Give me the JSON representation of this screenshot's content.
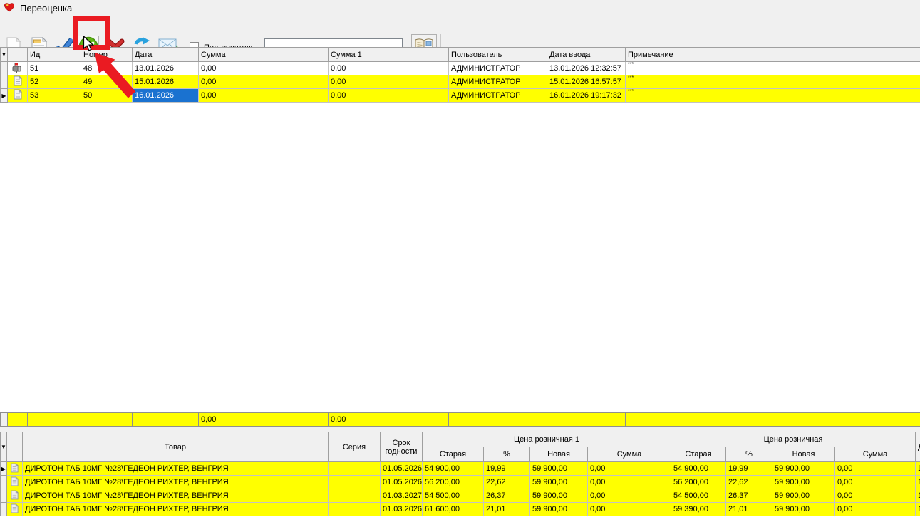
{
  "window": {
    "title": "Переоценка",
    "app_icon": "heart-icon"
  },
  "toolbar": {
    "buttons": [
      {
        "icon": "new-document-icon"
      },
      {
        "icon": "edit-document-icon"
      },
      {
        "icon": "blue-checkmark-icon"
      },
      {
        "icon": "green-approve-icon"
      },
      {
        "icon": "red-cross-icon"
      },
      {
        "icon": "refresh-icon"
      },
      {
        "icon": "send-mail-icon"
      },
      {
        "icon": "book-icon"
      }
    ],
    "user_checkbox_label": "Пользователь",
    "user_checkbox_checked": false,
    "user_input_value": ""
  },
  "icons": {
    "filter_arrow": "▼",
    "row_pointer": "▶"
  },
  "colors": {
    "row_highlight": "#ffff00",
    "cell_selection": "#1a72d0",
    "annotation_red": "#ea1b22"
  },
  "doc_table": {
    "columns": [
      "Ид",
      "Номер",
      "Дата",
      "Сумма",
      "Сумма 1",
      "Пользователь",
      "Дата ввода",
      "Примечание"
    ],
    "rows": [
      {
        "id": "51",
        "num": "48",
        "date": "13.01.2026",
        "sum": "0,00",
        "sum1": "0,00",
        "user": "АДМИНИСТРАТОР",
        "entered": "13.01.2026 12:32:57",
        "note": "***"
      },
      {
        "id": "52",
        "num": "49",
        "date": "15.01.2026",
        "sum": "0,00",
        "sum1": "0,00",
        "user": "АДМИНИСТРАТОР",
        "entered": "15.01.2026 16:57:57",
        "note": "***"
      },
      {
        "id": "53",
        "num": "50",
        "date": "16.01.2026",
        "sum": "0,00",
        "sum1": "0,00",
        "user": "АДМИНИСТРАТОР",
        "entered": "16.01.2026 19:17:32",
        "note": "***"
      }
    ],
    "summary": {
      "sum": "0,00",
      "sum1": "0,00"
    }
  },
  "items_table": {
    "col_product": "Товар",
    "col_series": "Серия",
    "col_expiry": "Срок годности",
    "group1": "Цена розничная 1",
    "group2": "Цена розничная",
    "sub": [
      "Старая",
      "%",
      "Новая",
      "Сумма"
    ],
    "last_col_header": "Д",
    "rows": [
      {
        "product": "ДИРОТОН ТАБ 10МГ №28\\ГЕДЕОН РИХТЕР, ВЕНГРИЯ",
        "series": "",
        "expiry": "01.05.2026",
        "p1": [
          "54 900,00",
          "19,99",
          "59 900,00",
          "0,00"
        ],
        "p2": [
          "54 900,00",
          "19,99",
          "59 900,00",
          "0,00"
        ],
        "extra": "1"
      },
      {
        "product": "ДИРОТОН ТАБ 10МГ №28\\ГЕДЕОН РИХТЕР, ВЕНГРИЯ",
        "series": "",
        "expiry": "01.05.2026",
        "p1": [
          "56 200,00",
          "22,62",
          "59 900,00",
          "0,00"
        ],
        "p2": [
          "56 200,00",
          "22,62",
          "59 900,00",
          "0,00"
        ],
        "extra": "1"
      },
      {
        "product": "ДИРОТОН ТАБ 10МГ №28\\ГЕДЕОН РИХТЕР, ВЕНГРИЯ",
        "series": "",
        "expiry": "01.03.2027",
        "p1": [
          "54 500,00",
          "26,37",
          "59 900,00",
          "0,00"
        ],
        "p2": [
          "54 500,00",
          "26,37",
          "59 900,00",
          "0,00"
        ],
        "extra": "1"
      },
      {
        "product": "ДИРОТОН ТАБ 10МГ №28\\ГЕДЕОН РИХТЕР, ВЕНГРИЯ",
        "series": "",
        "expiry": "01.03.2026",
        "p1": [
          "61 600,00",
          "21,01",
          "59 900,00",
          "0,00"
        ],
        "p2": [
          "59 390,00",
          "21,01",
          "59 900,00",
          "0,00"
        ],
        "extra": "1"
      }
    ]
  }
}
